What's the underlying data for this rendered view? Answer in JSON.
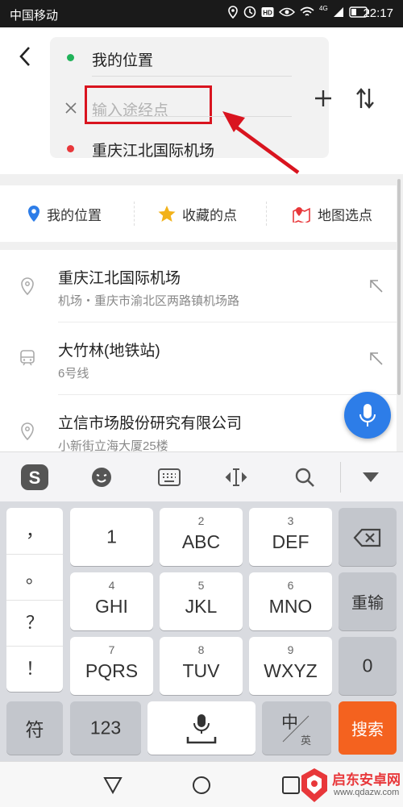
{
  "status_bar": {
    "carrier": "中国移动",
    "time": "22:17",
    "signal": "4G"
  },
  "route": {
    "start": "我的位置",
    "waypoint_placeholder": "输入途经点",
    "destination": "重庆江北国际机场",
    "start_color": "#21b35a",
    "dest_color": "#e8373a",
    "highlight_color": "#d9141f"
  },
  "quick_actions": [
    {
      "label": "我的位置",
      "icon": "location-pin-icon"
    },
    {
      "label": "收藏的点",
      "icon": "star-icon"
    },
    {
      "label": "地图选点",
      "icon": "map-pick-icon"
    }
  ],
  "results": [
    {
      "title": "重庆江北国际机场",
      "subtitle": "机场・重庆市渝北区两路镇机场路",
      "icon": "location-pin-icon"
    },
    {
      "title": "大竹林(地铁站)",
      "subtitle": "6号线",
      "icon": "subway-icon"
    },
    {
      "title": "立信市场股份研究有限公司",
      "subtitle": "小新街立海大厦25楼",
      "icon": "location-pin-icon"
    }
  ],
  "keyboard": {
    "punctuation": [
      "，",
      "。",
      "？",
      "！"
    ],
    "keys": [
      {
        "num": "",
        "label": "1"
      },
      {
        "num": "2",
        "label": "ABC"
      },
      {
        "num": "3",
        "label": "DEF"
      },
      {
        "num": "4",
        "label": "GHI"
      },
      {
        "num": "5",
        "label": "JKL"
      },
      {
        "num": "6",
        "label": "MNO"
      },
      {
        "num": "7",
        "label": "PQRS"
      },
      {
        "num": "8",
        "label": "TUV"
      },
      {
        "num": "9",
        "label": "WXYZ"
      }
    ],
    "reenter": "重输",
    "zero": "0",
    "symbols": "符",
    "numbers": "123",
    "lang_main": "中",
    "lang_sub": "英",
    "search": "搜索",
    "accent": "#f4621f"
  },
  "watermark": "启东安卓网",
  "watermark_url": "www.qdazw.com"
}
